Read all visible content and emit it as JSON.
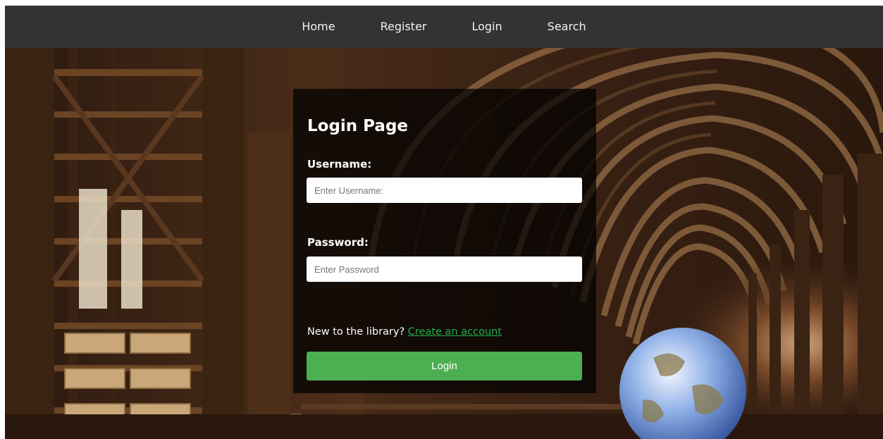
{
  "nav": {
    "items": [
      {
        "label": "Home"
      },
      {
        "label": "Register"
      },
      {
        "label": "Login"
      },
      {
        "label": "Search"
      }
    ]
  },
  "login": {
    "title": "Login Page",
    "username_label": "Username:",
    "username_placeholder": "Enter Username:",
    "password_label": "Password:",
    "password_placeholder": "Enter Password",
    "signup_prompt": "New to the library?",
    "signup_link": "Create an account",
    "submit_label": "Login"
  },
  "colors": {
    "navbar": "#333333",
    "button": "#4caf50",
    "link": "#22b14c"
  }
}
